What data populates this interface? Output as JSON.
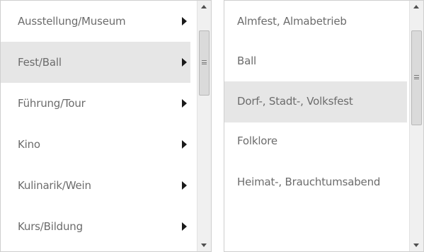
{
  "categories": {
    "items": [
      {
        "label": "Ausstellung/Museum",
        "selected": false
      },
      {
        "label": "Fest/Ball",
        "selected": true
      },
      {
        "label": "Führung/Tour",
        "selected": false
      },
      {
        "label": "Kino",
        "selected": false
      },
      {
        "label": "Kulinarik/Wein",
        "selected": false
      },
      {
        "label": "Kurs/Bildung",
        "selected": false
      }
    ],
    "item_icon": "chevron-right-icon"
  },
  "subcategories": {
    "items": [
      {
        "label": "Almfest, Almabetrieb",
        "selected": false
      },
      {
        "label": "Ball",
        "selected": false
      },
      {
        "label": "Dorf-, Stadt-, Volksfest",
        "selected": true
      },
      {
        "label": "Folklore",
        "selected": false
      },
      {
        "label": "Heimat-, Brauchtumsabend",
        "selected": false
      },
      {
        "label": "",
        "selected": false
      }
    ]
  },
  "colors": {
    "selected_background": "#e6e6e6",
    "text": "#6c6c6c",
    "scrollbar_track": "#f0f0f0",
    "scrollbar_thumb": "#dadada"
  }
}
